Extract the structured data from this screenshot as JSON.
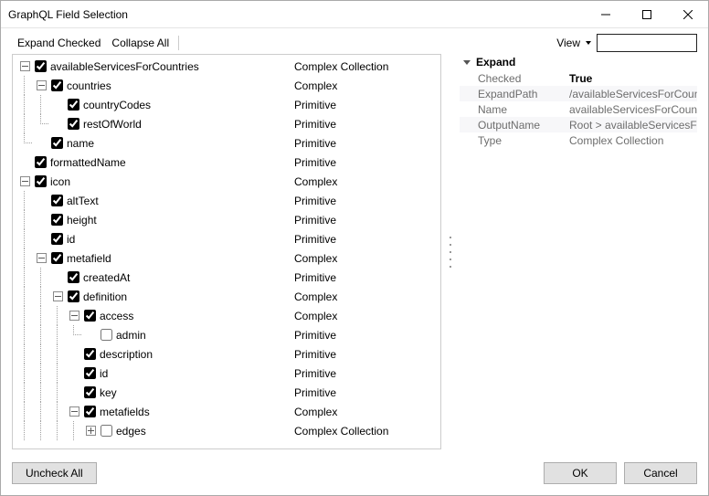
{
  "window": {
    "title": "GraphQL Field Selection"
  },
  "toolbar": {
    "expand_checked": "Expand Checked",
    "collapse_all": "Collapse All",
    "view_label": "View",
    "filter_value": ""
  },
  "buttons": {
    "uncheck_all": "Uncheck All",
    "ok": "OK",
    "cancel": "Cancel"
  },
  "tree": {
    "nodes": [
      {
        "depth": 0,
        "exp": "minus",
        "checked": true,
        "label": "availableServicesForCountries",
        "type": "Complex Collection",
        "guides": ""
      },
      {
        "depth": 1,
        "exp": "minus",
        "checked": true,
        "label": "countries",
        "type": "Complex",
        "guides": "|"
      },
      {
        "depth": 2,
        "exp": "",
        "checked": true,
        "label": "countryCodes",
        "type": "Primitive",
        "guides": "||"
      },
      {
        "depth": 2,
        "exp": "",
        "checked": true,
        "label": "restOfWorld",
        "type": "Primitive",
        "guides": "|L"
      },
      {
        "depth": 1,
        "exp": "",
        "checked": true,
        "label": "name",
        "type": "Primitive",
        "guides": "L"
      },
      {
        "depth": 0,
        "exp": "",
        "checked": true,
        "label": "formattedName",
        "type": "Primitive",
        "guides": ""
      },
      {
        "depth": 0,
        "exp": "minus",
        "checked": true,
        "label": "icon",
        "type": "Complex",
        "guides": ""
      },
      {
        "depth": 1,
        "exp": "",
        "checked": true,
        "label": "altText",
        "type": "Primitive",
        "guides": "|"
      },
      {
        "depth": 1,
        "exp": "",
        "checked": true,
        "label": "height",
        "type": "Primitive",
        "guides": "|"
      },
      {
        "depth": 1,
        "exp": "",
        "checked": true,
        "label": "id",
        "type": "Primitive",
        "guides": "|"
      },
      {
        "depth": 1,
        "exp": "minus",
        "checked": true,
        "label": "metafield",
        "type": "Complex",
        "guides": "|"
      },
      {
        "depth": 2,
        "exp": "",
        "checked": true,
        "label": "createdAt",
        "type": "Primitive",
        "guides": "||"
      },
      {
        "depth": 2,
        "exp": "minus",
        "checked": true,
        "label": "definition",
        "type": "Complex",
        "guides": "||"
      },
      {
        "depth": 3,
        "exp": "minus",
        "checked": true,
        "label": "access",
        "type": "Complex",
        "guides": "|||"
      },
      {
        "depth": 4,
        "exp": "",
        "checked": false,
        "label": "admin",
        "type": "Primitive",
        "guides": "|||L"
      },
      {
        "depth": 3,
        "exp": "",
        "checked": true,
        "label": "description",
        "type": "Primitive",
        "guides": "|||"
      },
      {
        "depth": 3,
        "exp": "",
        "checked": true,
        "label": "id",
        "type": "Primitive",
        "guides": "|||"
      },
      {
        "depth": 3,
        "exp": "",
        "checked": true,
        "label": "key",
        "type": "Primitive",
        "guides": "|||"
      },
      {
        "depth": 3,
        "exp": "minus",
        "checked": true,
        "label": "metafields",
        "type": "Complex",
        "guides": "|||"
      },
      {
        "depth": 4,
        "exp": "plus",
        "checked": false,
        "label": "edges",
        "type": "Complex Collection",
        "guides": "||||"
      }
    ]
  },
  "properties": {
    "header": "Expand",
    "rows": [
      {
        "k": "Checked",
        "v": "True",
        "bold": true
      },
      {
        "k": "ExpandPath",
        "v": "/availableServicesForCountries"
      },
      {
        "k": "Name",
        "v": "availableServicesForCountries"
      },
      {
        "k": "OutputName",
        "v": "Root > availableServicesForCountries"
      },
      {
        "k": "Type",
        "v": "Complex Collection"
      }
    ]
  }
}
